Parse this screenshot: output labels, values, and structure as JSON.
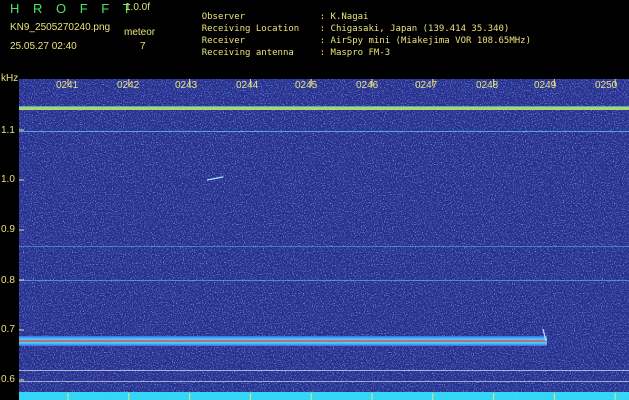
{
  "header": {
    "title": "H R O F F T",
    "version": "1.0.0f",
    "filename": "KN9_2505270240.png",
    "datetime": "25.05.27 02:40",
    "meteor_label": "meteor",
    "meteor_count": "7"
  },
  "info": [
    {
      "key": "Observer",
      "value": ": K.Nagai"
    },
    {
      "key": "Receiving Location",
      "value": ": Chigasaki, Japan (139.414 35.340)"
    },
    {
      "key": "Receiver",
      "value": ": AirSpy mini (Miakejima VOR 108.65MHz)"
    },
    {
      "key": "Receiving antenna",
      "value": ": Maspro FM-3"
    }
  ],
  "axis": {
    "y_unit": "kHz",
    "x_ticks": [
      "0241",
      "0242",
      "0243",
      "0244",
      "0245",
      "0246",
      "0247",
      "0248",
      "0249",
      "0250"
    ],
    "y_ticks": [
      "1.1",
      "1.0",
      "0.9",
      "0.8",
      "0.7",
      "0.6"
    ]
  },
  "colors": {
    "background": "#26318f",
    "text": "#e9e27a",
    "title": "#4fe36a"
  }
}
